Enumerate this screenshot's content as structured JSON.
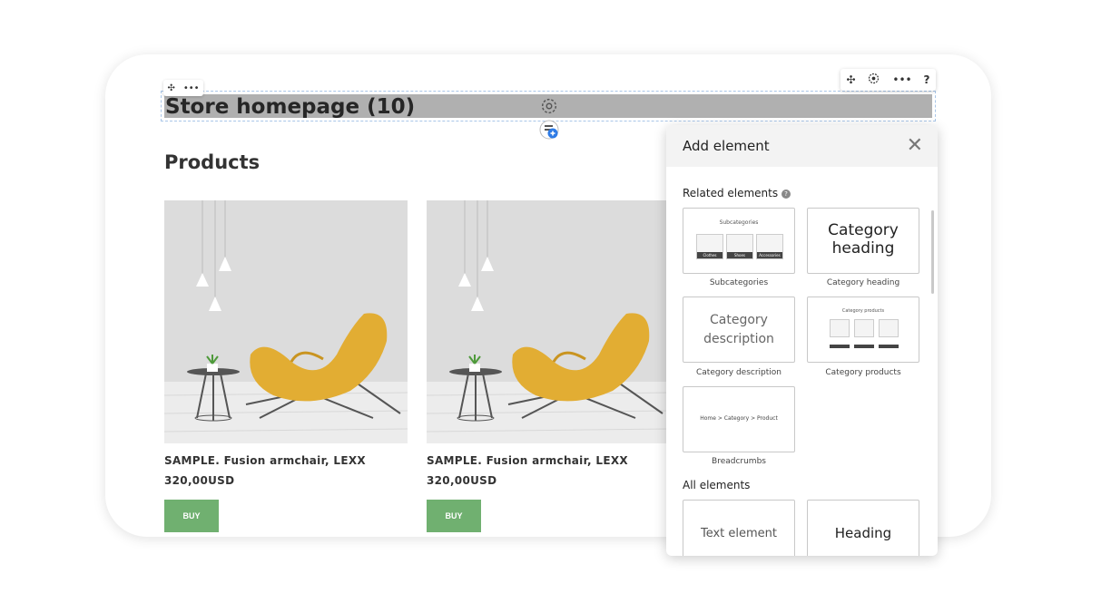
{
  "page": {
    "title": "Store homepage (10)",
    "products_heading": "Products"
  },
  "toolbar": {
    "mini_move": "✣",
    "mini_more": "•••",
    "move": "✣",
    "more": "•••",
    "help": "?"
  },
  "products": [
    {
      "name": "SAMPLE. Fusion armchair, LEXX",
      "price": "320,00USD",
      "buy": "BUY"
    },
    {
      "name": "SAMPLE. Fusion armchair, LEXX",
      "price": "320,00USD",
      "buy": "BUY"
    }
  ],
  "panel": {
    "title": "Add element",
    "close": "✕",
    "related_label": "Related elements",
    "all_label": "All elements",
    "related": [
      {
        "caption": "Subcategories",
        "preview_title": "Subcategories",
        "thumb_labels": [
          "Clothes",
          "Shoes",
          "Accessories"
        ]
      },
      {
        "caption": "Category heading",
        "preview_text": "Category heading"
      },
      {
        "caption": "Category description",
        "preview_text": "Category description"
      },
      {
        "caption": "Category products",
        "preview_title": "Category products",
        "thumb_price": "$320,00",
        "thumb_button": "BUY NOW"
      },
      {
        "caption": "Breadcrumbs",
        "preview_text": "Home > Category > Product"
      }
    ],
    "all": [
      {
        "preview_text": "Text element"
      },
      {
        "preview_text": "Heading"
      }
    ]
  },
  "colors": {
    "title_bar": "#b0b0b0",
    "buy": "#70b070",
    "accent": "#2f7be5",
    "chair": "#e2ad33"
  }
}
